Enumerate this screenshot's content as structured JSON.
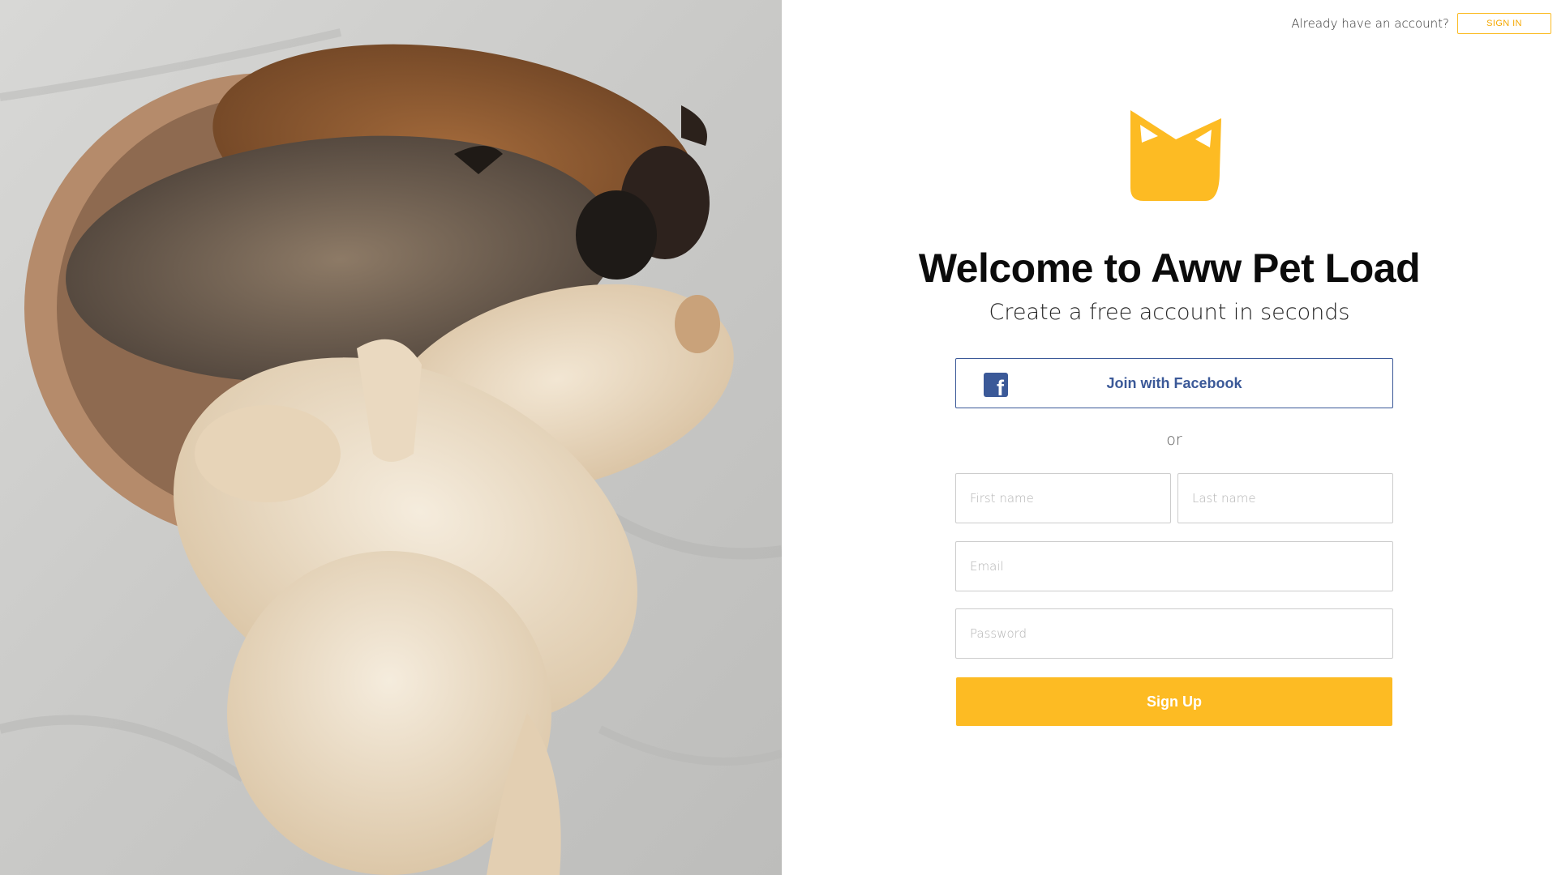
{
  "header": {
    "account_prompt": "Already have an account?",
    "signin_label": "SIGN IN"
  },
  "photo": {
    "icon": "puppies-in-bowl-photo"
  },
  "logo": {
    "icon": "cat-head-logo",
    "color": "#fdbb23"
  },
  "main": {
    "title": "Welcome to Aww Pet Load",
    "subtitle": "Create a free account in seconds"
  },
  "form": {
    "facebook_label": "Join with Facebook",
    "facebook_icon": "facebook-icon",
    "facebook_color": "#3b5998",
    "divider_text": "or",
    "first_name_placeholder": "First name",
    "last_name_placeholder": "Last name",
    "email_placeholder": "Email",
    "password_placeholder": "Password",
    "submit_label": "Sign Up",
    "accent_color": "#fdbb23"
  }
}
